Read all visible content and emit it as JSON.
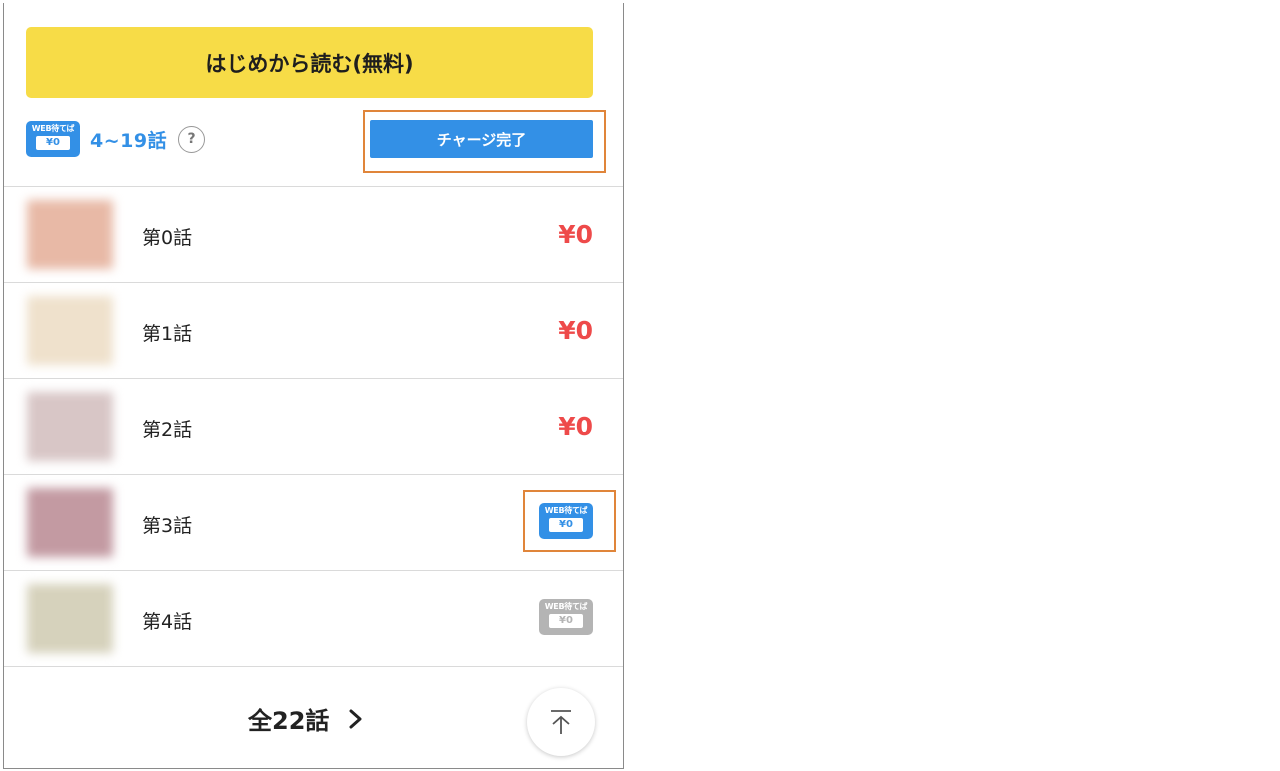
{
  "start_button": {
    "label": "はじめから読む(無料)"
  },
  "wait_section": {
    "badge": {
      "top": "WEB待てば",
      "price": "¥0"
    },
    "range": "4~19話",
    "help": "?",
    "charge_label": "チャージ完了"
  },
  "episodes": [
    {
      "title": "第0話",
      "price": "¥0",
      "type": "price",
      "thumb_color": "#e8b9a6"
    },
    {
      "title": "第1話",
      "price": "¥0",
      "type": "price",
      "thumb_color": "#efe1cc"
    },
    {
      "title": "第2話",
      "price": "¥0",
      "type": "price",
      "thumb_color": "#d8c6c6"
    },
    {
      "title": "第3話",
      "type": "wait_badge_active",
      "badge_top": "WEB待てば",
      "badge_price": "¥0",
      "thumb_color": "#c39aa2"
    },
    {
      "title": "第4話",
      "type": "wait_badge_inactive",
      "badge_top": "WEB待てば",
      "badge_price": "¥0",
      "thumb_color": "#d6d2bc"
    }
  ],
  "footer": {
    "total_label": "全22話"
  },
  "colors": {
    "accent_blue": "#3390e6",
    "yellow": "#f7dc47",
    "price_red": "#ee4a4a",
    "highlight_orange": "#e0853a"
  }
}
